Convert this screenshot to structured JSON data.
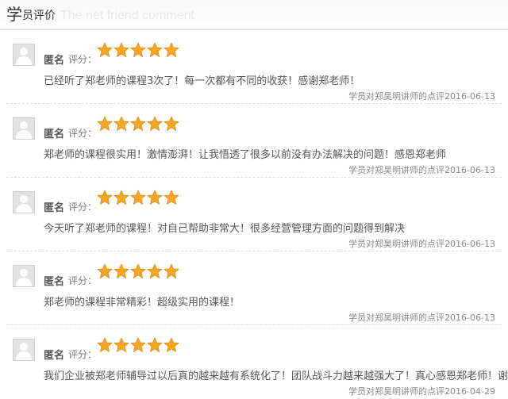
{
  "header": {
    "title_big": "学",
    "title_rest": "员评价",
    "title_en": "The net friend comment"
  },
  "colors": {
    "star_fill": "#f5a623",
    "star_stroke": "#e08a10"
  },
  "reviews": [
    {
      "name": "匿名",
      "score_label": "评分：",
      "rating": 5,
      "content": "已经听了郑老师的课程3次了！每一次都有不同的收获！感谢郑老师！",
      "target": "学员对郑昊明讲师的点评",
      "date": "2016-06-13"
    },
    {
      "name": "匿名",
      "score_label": "评分：",
      "rating": 5,
      "content": "郑老师的课程很实用！激情澎湃！让我悟透了很多以前没有办法解决的问题！感恩郑老师",
      "target": "学员对郑昊明讲师的点评",
      "date": "2016-06-13"
    },
    {
      "name": "匿名",
      "score_label": "评分：",
      "rating": 5,
      "content": "今天听了郑老师的课程！对自己帮助非常大！很多经营管理方面的问题得到解决",
      "target": "学员对郑昊明讲师的点评",
      "date": "2016-06-13"
    },
    {
      "name": "匿名",
      "score_label": "评分：",
      "rating": 5,
      "content": "郑老师的课程非常精彩！超级实用的课程！",
      "target": "学员对郑昊明讲师的点评",
      "date": "2016-06-13"
    },
    {
      "name": "匿名",
      "score_label": "评分：",
      "rating": 5,
      "content": "我们企业被郑老师辅导过以后真的越来越有系统化了！团队战斗力越来越强大了！真心感恩郑老师！谢谢",
      "target": "学员对郑昊明讲师的点评",
      "date": "2016-04-29"
    }
  ]
}
